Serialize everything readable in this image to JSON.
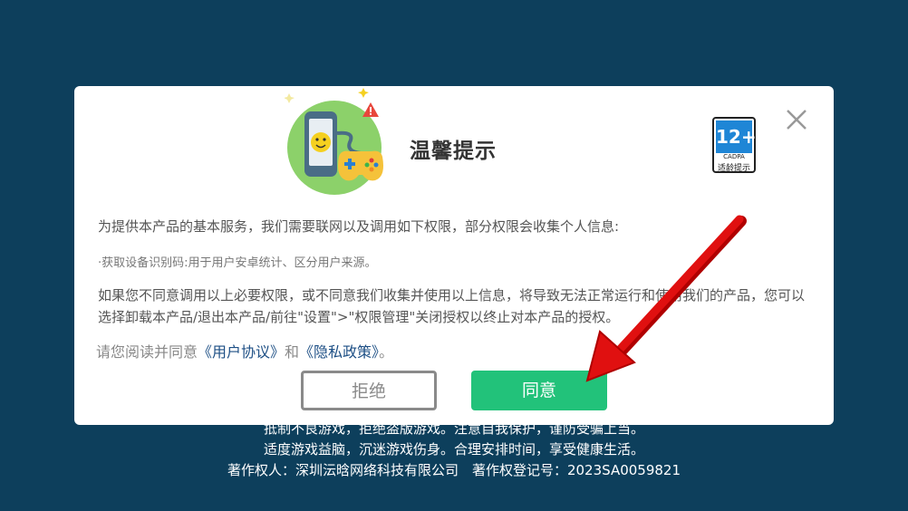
{
  "footer": {
    "line1": "抵制不良游戏，拒绝盗版游戏。注意自我保护，谨防受骗上当。",
    "line2": "适度游戏益脑，沉迷游戏伤身。合理安排时间，享受健康生活。",
    "line3": "著作权人：深圳沄晗网络科技有限公司　著作权登记号：2023SA0059821"
  },
  "dialog": {
    "title": "温馨提示",
    "age_badge": {
      "number": "12+",
      "org": "CADPA",
      "label": "适龄提示"
    },
    "intro": "为提供本产品的基本服务，我们需要联网以及调用如下权限，部分权限会收集个人信息:",
    "permission": "·获取设备识别码:用于用户安卓统计、区分用户来源。",
    "notice": "如果您不同意调用以上必要权限，或不同意我们收集并使用以上信息，将导致无法正常运行和使用我们的产品，您可以选择卸载本产品/退出本产品/前往\"设置\">\"权限管理\"关闭授权以终止对本产品的授权。",
    "agree_prefix": "请您阅读并同意",
    "user_agreement": "《用户协议》",
    "and": "和",
    "privacy_policy": "《隐私政策》",
    "agree_suffix": "。",
    "refuse_label": "拒绝",
    "agree_label": "同意"
  },
  "colors": {
    "background": "#0d3f5c",
    "agree_button": "#22c27a",
    "link": "#1d4f85",
    "arrow": "#e01010"
  }
}
